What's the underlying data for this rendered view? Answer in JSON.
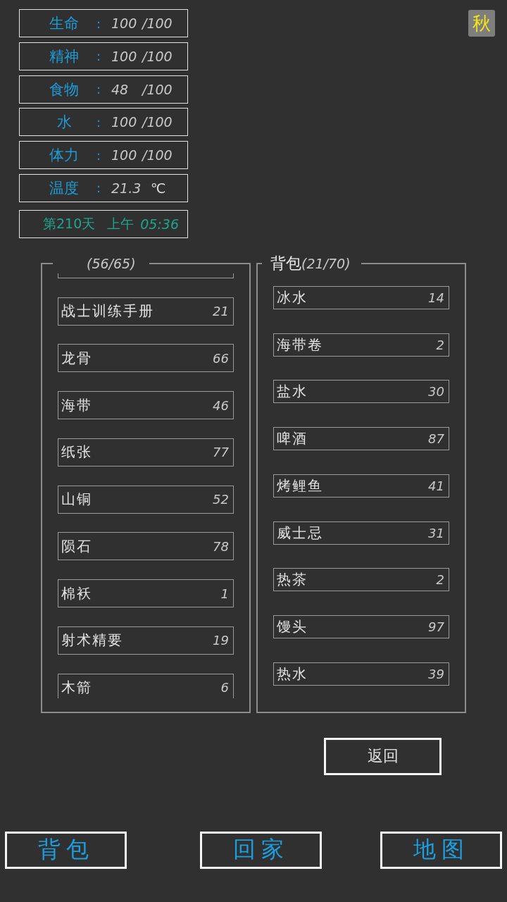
{
  "stats": [
    {
      "label": "生命",
      "sep": ":",
      "value": "100",
      "max": "/100"
    },
    {
      "label": "精神",
      "sep": ":",
      "value": "100",
      "max": "/100"
    },
    {
      "label": "食物",
      "sep": ":",
      "value": "48",
      "max": "/100"
    },
    {
      "label": "水",
      "sep": ":",
      "value": "100",
      "max": "/100"
    },
    {
      "label": "体力",
      "sep": ":",
      "value": "100",
      "max": "/100"
    },
    {
      "label": "温度",
      "sep": ":",
      "value": "21.3",
      "unit": "℃"
    }
  ],
  "clock": {
    "day": "第210天",
    "period": "上午",
    "time": "05:36"
  },
  "season_badge": "秋",
  "panels": [
    {
      "kind": "storage",
      "count": "(56/65)",
      "scrolled": true,
      "items": [
        {
          "name": "战士训练手册",
          "count": "21"
        },
        {
          "name": "龙骨",
          "count": "66"
        },
        {
          "name": "海带",
          "count": "46"
        },
        {
          "name": "纸张",
          "count": "77"
        },
        {
          "name": "山铜",
          "count": "52"
        },
        {
          "name": "陨石",
          "count": "78"
        },
        {
          "name": "棉袄",
          "count": "1"
        },
        {
          "name": "射术精要",
          "count": "19"
        },
        {
          "name": "木箭",
          "count": "6"
        }
      ]
    },
    {
      "kind": "bag",
      "title": "背包",
      "count": "(21/70)",
      "scrolled": false,
      "items": [
        {
          "name": "冰水",
          "count": "14"
        },
        {
          "name": "海带卷",
          "count": "2"
        },
        {
          "name": "盐水",
          "count": "30"
        },
        {
          "name": "啤酒",
          "count": "87"
        },
        {
          "name": "烤鲤鱼",
          "count": "41"
        },
        {
          "name": "威士忌",
          "count": "31"
        },
        {
          "name": "热茶",
          "count": "2"
        },
        {
          "name": "馒头",
          "count": "97"
        },
        {
          "name": "热水",
          "count": "39"
        }
      ]
    }
  ],
  "back_button": "返回",
  "nav": [
    {
      "label": "背包"
    },
    {
      "label": "回家"
    },
    {
      "label": "地图"
    }
  ]
}
